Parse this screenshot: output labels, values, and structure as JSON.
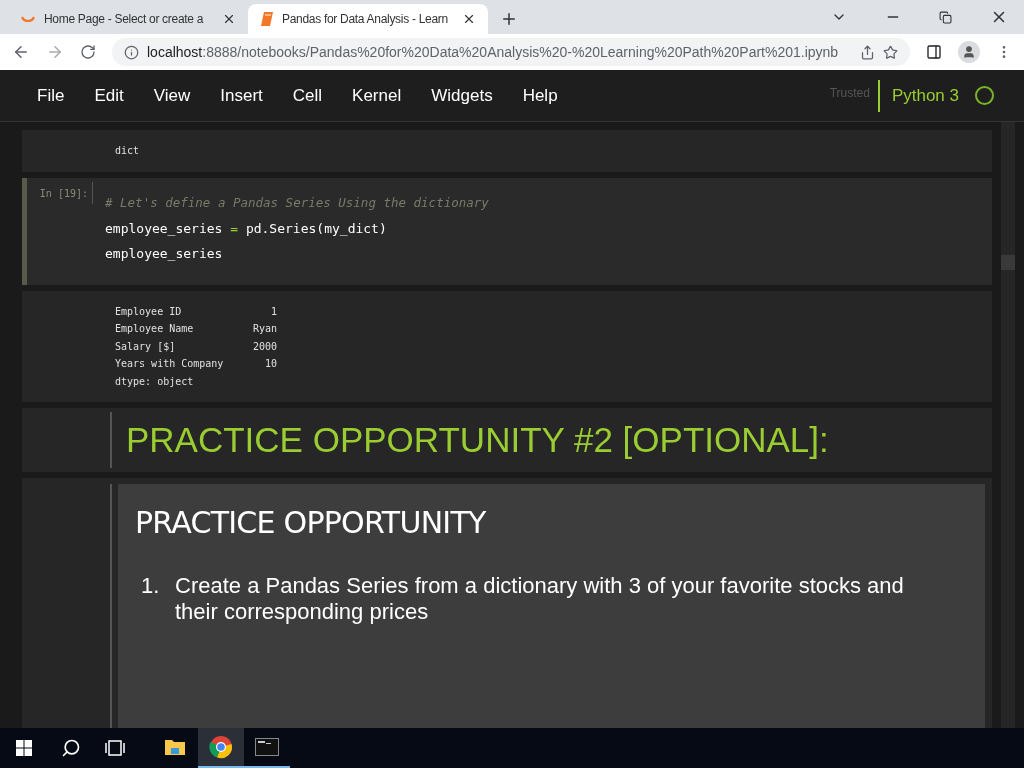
{
  "browser": {
    "tabs": [
      {
        "title": "Home Page - Select or create a",
        "selected": false
      },
      {
        "title": "Pandas for Data Analysis - Learn",
        "selected": true
      }
    ],
    "url_host": "localhost",
    "url_rest": ":8888/notebooks/Pandas%20for%20Data%20Analysis%20-%20Learning%20Path%20Part%201.ipynb"
  },
  "menubar": {
    "items": [
      "File",
      "Edit",
      "View",
      "Insert",
      "Cell",
      "Kernel",
      "Widgets",
      "Help"
    ],
    "trusted": "Trusted",
    "kernel": "Python 3",
    "kernel_busy": false
  },
  "cells": [
    {
      "kind": "output",
      "lines": [
        [
          "dict"
        ]
      ]
    },
    {
      "kind": "code",
      "prompt": "In [19]:",
      "comment": "# Let's define a Pandas Series Using the dictionary",
      "lines": [
        [
          "employee_series ",
          "=",
          " pd.Series(my_dict)"
        ],
        [
          "employee_series"
        ]
      ]
    },
    {
      "kind": "output",
      "lines": [
        [
          "Employee ID",
          "1"
        ],
        [
          "Employee Name",
          "Ryan"
        ],
        [
          "Salary [$]",
          "2000"
        ],
        [
          "Years with Company",
          "10"
        ],
        [
          "dtype: object"
        ]
      ]
    },
    {
      "kind": "heading",
      "text": "PRACTICE OPPORTUNITY #2 [OPTIONAL]:"
    },
    {
      "kind": "box",
      "title": "PRACTICE OPPORTUNITY",
      "items": [
        {
          "number": "1.",
          "text": "Create a Pandas Series from a dictionary with 3 of your favorite stocks and their corresponding prices"
        }
      ]
    }
  ],
  "taskbar": [
    {
      "kind": "explorer",
      "active": false
    },
    {
      "kind": "chrome",
      "active": true
    },
    {
      "kind": "terminal",
      "active": true
    }
  ]
}
